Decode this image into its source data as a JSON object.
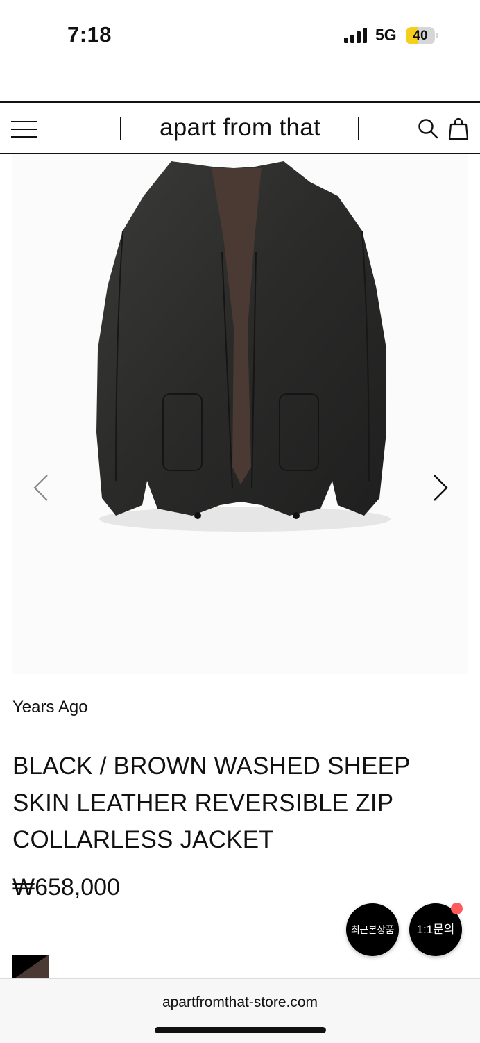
{
  "status_bar": {
    "time": "7:18",
    "network": "5G",
    "battery_level": "40",
    "battery_fraction": 0.4,
    "battery_color": "#f6cf1d"
  },
  "header": {
    "brand": "apart from that",
    "menu_icon": "hamburger-menu-icon",
    "search_icon": "search-icon",
    "cart_icon": "shopping-bag-icon"
  },
  "gallery": {
    "prev_icon": "chevron-left-icon",
    "next_icon": "chevron-right-icon"
  },
  "product": {
    "brand_line": "Years Ago",
    "title": "BLACK / BROWN WASHED SHEEP SKIN LEATHER REVERSIBLE ZIP COLLARLESS JACKET",
    "price": "₩658,000",
    "swatch_colors": [
      "#000000",
      "#4a3a33"
    ]
  },
  "floating": {
    "recent_label": "최근본상품",
    "inquiry_label": "1:1문의",
    "notification_color": "#ff5b5b"
  },
  "browser": {
    "url": "apartfromthat-store.com"
  }
}
